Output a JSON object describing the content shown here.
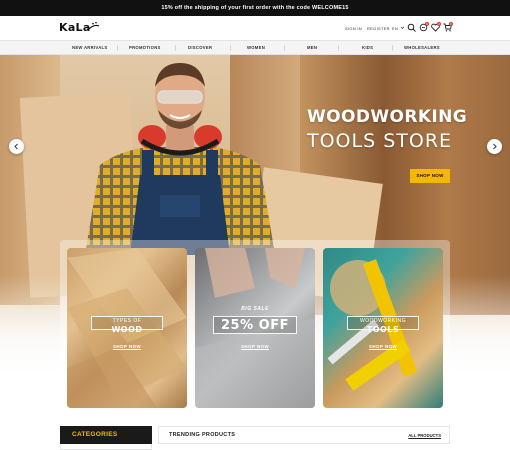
{
  "promo": {
    "text": "15% off the shipping of your first order with the code WELCOME15"
  },
  "header": {
    "logo": "KaLa",
    "sign_in": "SIGN IN",
    "register": "REGISTER",
    "language": "EN",
    "wishlist_count": "0",
    "compare_count": "0",
    "cart_count": "0"
  },
  "nav": {
    "items": [
      "NEW ARRIVALS",
      "PROMOTIONS",
      "DISCOVER",
      "WOMEN",
      "MEN",
      "KIDS",
      "WHOLESALERS"
    ]
  },
  "hero": {
    "title_line1": "WOODWORKING",
    "title_line2": "TOOLS STORE",
    "button": "SHOP NOW"
  },
  "cards": [
    {
      "small": "TYPES OF",
      "big": "WOOD",
      "shop": "SHOP NOW"
    },
    {
      "small": "BIG SALE",
      "big": "25% OFF",
      "shop": "SHOP NOW"
    },
    {
      "small": "WOODWORKING",
      "big": "TOOLS",
      "shop": "SHOP NOW"
    }
  ],
  "categories": {
    "title": "CATEGORIES"
  },
  "trending": {
    "title": "TRENDING PRODUCTS",
    "all": "ALL PRODUCTS"
  },
  "colors": {
    "accent": "#f5b800",
    "dark": "#111111"
  }
}
